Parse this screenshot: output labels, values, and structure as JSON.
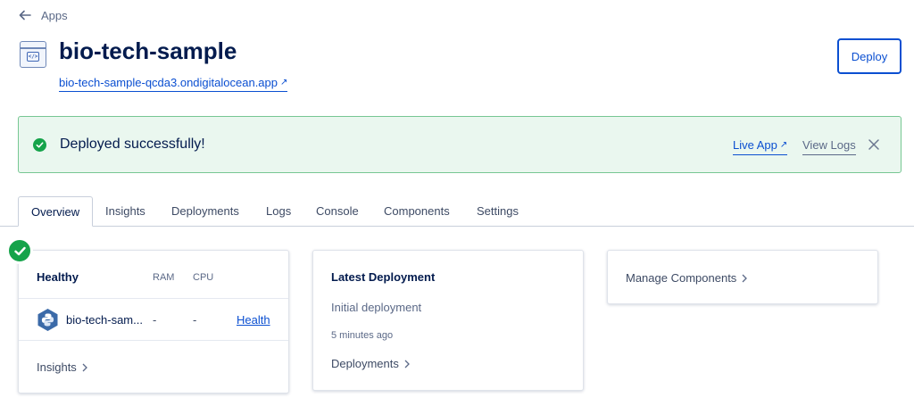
{
  "nav": {
    "back_label": "Apps"
  },
  "header": {
    "title": "bio-tech-sample",
    "url": "bio-tech-sample-qcda3.ondigitalocean.app",
    "deploy_label": "Deploy",
    "icon": "app-code-window-icon"
  },
  "banner": {
    "message": "Deployed successfully!",
    "live_app_label": "Live App",
    "view_logs_label": "View Logs",
    "status_color": "#15a34a"
  },
  "tabs": [
    {
      "label": "Overview",
      "active": true
    },
    {
      "label": "Insights"
    },
    {
      "label": "Deployments"
    },
    {
      "label": "Logs"
    },
    {
      "label": "Console"
    },
    {
      "label": "Components"
    },
    {
      "label": "Settings"
    }
  ],
  "health_card": {
    "title": "Healthy",
    "col_ram": "RAM",
    "col_cpu": "CPU",
    "component": {
      "name": "bio-tech-sam...",
      "ram": "-",
      "cpu": "-",
      "health_link": "Health",
      "icon": "python-icon"
    },
    "insights_link": "Insights"
  },
  "deployment_card": {
    "title": "Latest Deployment",
    "description": "Initial deployment",
    "time": "5 minutes ago",
    "link": "Deployments"
  },
  "components_card": {
    "link": "Manage Components"
  },
  "colors": {
    "primary": "#0b4fd1",
    "text": "#031b4e",
    "success": "#15a34a",
    "banner_bg": "#eaf7ef"
  }
}
